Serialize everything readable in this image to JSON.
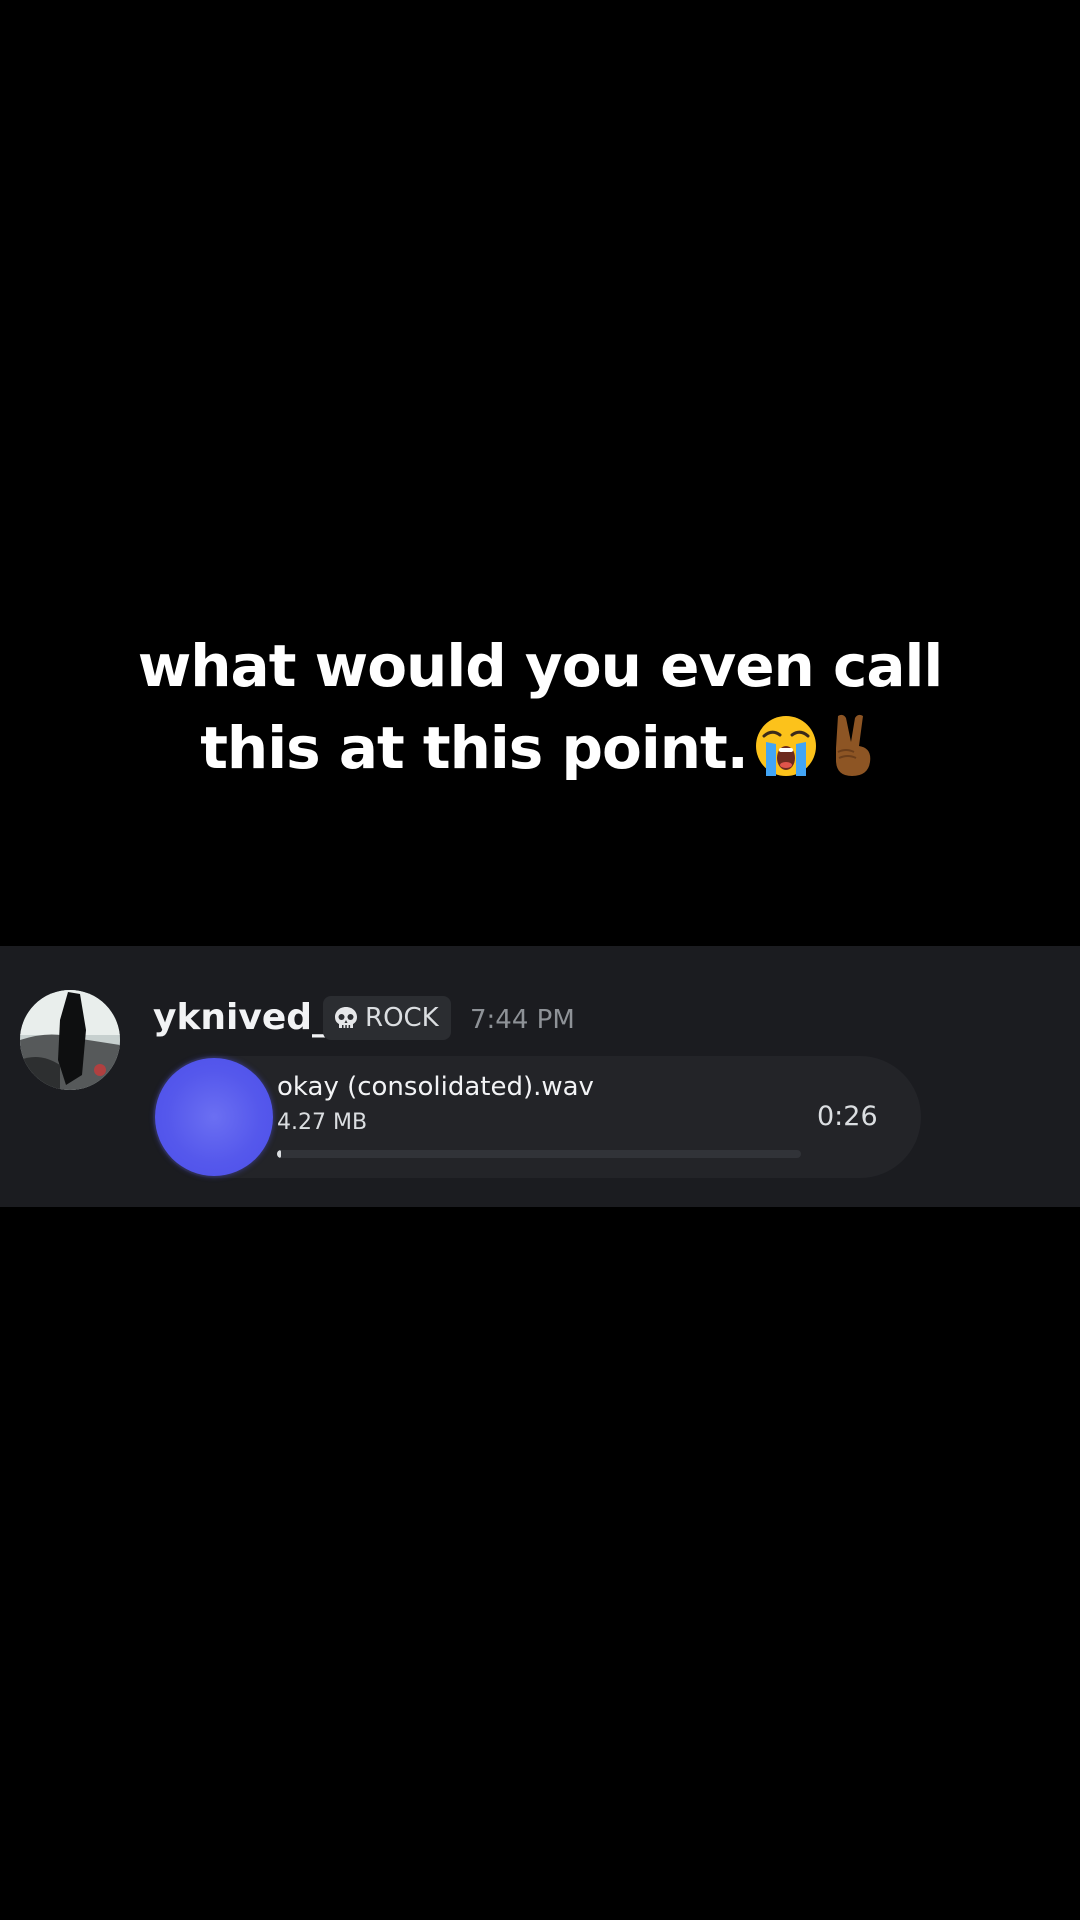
{
  "caption": {
    "line1": "what would you even call",
    "line2": "this at this point.",
    "emojis": [
      "loudly-crying-face-icon",
      "victory-hand-icon"
    ]
  },
  "message": {
    "username": "yknived_",
    "role_icon": "skull-icon",
    "role_label": "ROCK",
    "timestamp": "7:44 PM",
    "attachment": {
      "file_name": "okay (consolidated).wav",
      "file_size": "4.27 MB",
      "duration": "0:26",
      "progress": 0.0
    }
  },
  "colors": {
    "background": "#000000",
    "panel": "#1b1c20",
    "attachment_bg": "#232428",
    "play_button": "#5558ec",
    "timestamp": "#8e9297",
    "text": "#f2f3f5"
  }
}
